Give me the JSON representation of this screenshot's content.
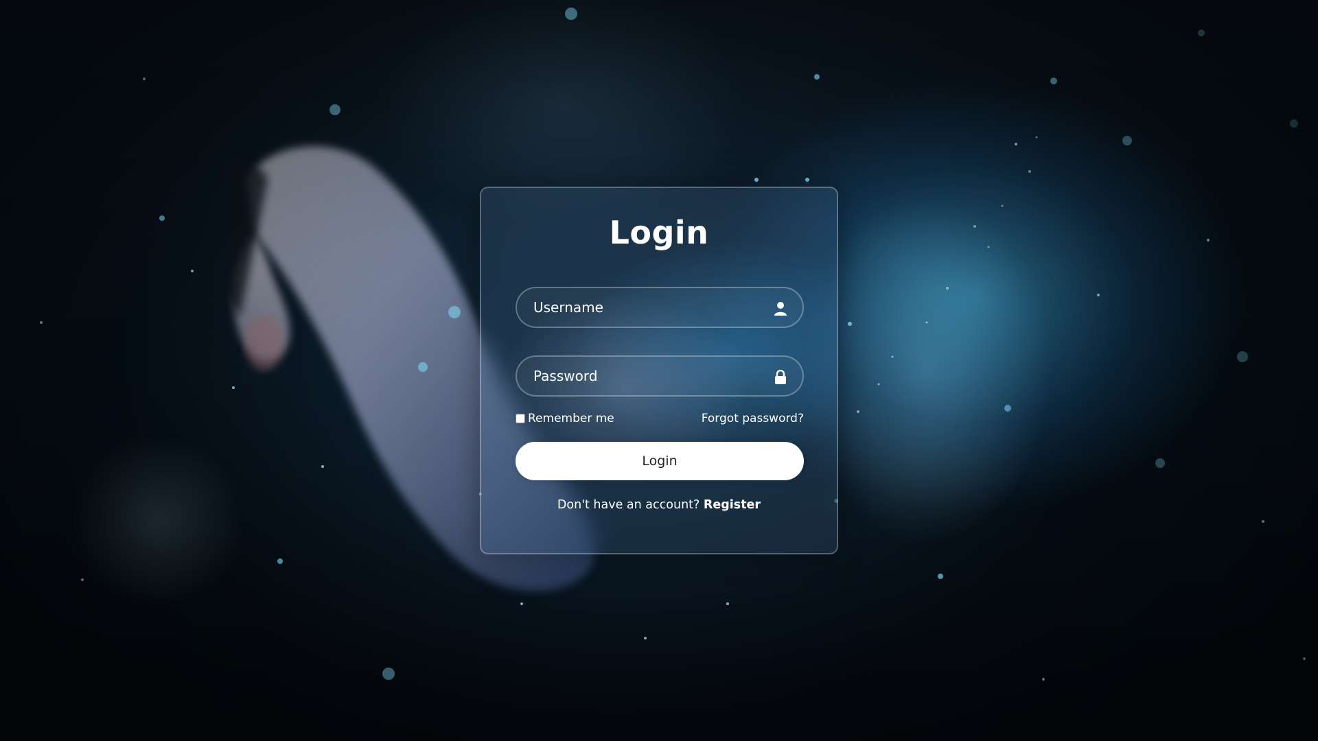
{
  "login_form": {
    "title": "Login",
    "username": {
      "placeholder": "Username",
      "value": "",
      "icon": "user-icon"
    },
    "password": {
      "placeholder": "Password",
      "value": "",
      "icon": "lock-icon"
    },
    "remember_me": {
      "label": "Remember me",
      "checked": false
    },
    "forgot_password_label": "Forgot password?",
    "submit_label": "Login",
    "register_prompt": "Don't have an account?",
    "register_link_label": "Register"
  },
  "colors": {
    "text": "#ffffff",
    "button_background": "#ffffff",
    "button_text": "#222222",
    "background_accent": "#3fb4e8",
    "background_dark": "#06111a"
  }
}
